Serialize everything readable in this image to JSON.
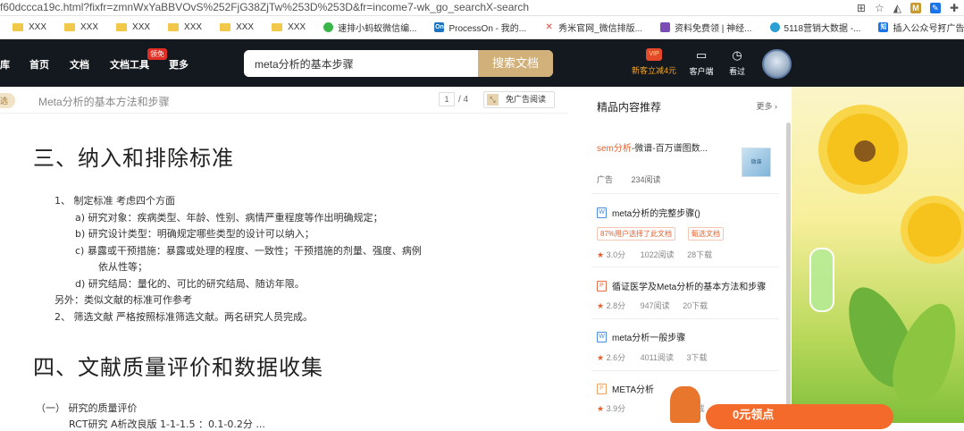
{
  "browser": {
    "url": "f60dccca19c.html?fixfr=zmnWxYaBBVOvS%252FjG38ZjTw%253D%253D&fr=income7-wk_go_searchX-search"
  },
  "bookmarks": [
    {
      "label": "XXX",
      "icon": "folder-icon"
    },
    {
      "label": "XXX",
      "icon": "folder-icon"
    },
    {
      "label": "XXX",
      "icon": "folder-icon"
    },
    {
      "label": "XXX",
      "icon": "folder-icon"
    },
    {
      "label": "XXX",
      "icon": "folder-icon"
    },
    {
      "label": "XXX",
      "icon": "folder-icon"
    },
    {
      "label": "速排小蚂蚁微信编...",
      "icon": "site-icon",
      "color": "#3bb54a"
    },
    {
      "label": "ProcessOn - 我的...",
      "icon": "site-icon",
      "color": "#1e73be",
      "glyph": "On"
    },
    {
      "label": "秀米官网_微信排版...",
      "icon": "site-icon",
      "color": "#e0463c"
    },
    {
      "label": "资料免费领 | 神经...",
      "icon": "site-icon",
      "color": "#7b4bb6"
    },
    {
      "label": "5118营销大数据 -...",
      "icon": "site-icon",
      "color": "#2a9fd6"
    },
    {
      "label": "插入公众号打广告...",
      "icon": "site-icon",
      "color": "#1a73e8",
      "glyph": "知"
    }
  ],
  "header": {
    "logo_fragment": "库",
    "nav": [
      "首页",
      "文档",
      "文档工具",
      "更多"
    ],
    "hot_badge": "领免",
    "search_value": "meta分析的基本步骤",
    "search_button": "搜索文档",
    "vip_label": "新客立减4元",
    "vip_icon_text": "VIP",
    "client_label": "客户端",
    "history_label": "看过"
  },
  "docbar": {
    "tag": "选",
    "title": "Meta分析的基本方法和步骤",
    "page_current": "1",
    "page_total": "/ 4",
    "adfree": "免广告阅读"
  },
  "doc": {
    "h1": "三、纳入和排除标准",
    "lines": [
      "1、 制定标准 考虑四个方面",
      "a)    研究对象：疾病类型、年龄、性别、病情严重程度等作出明确规定；",
      "b)    研究设计类型：明确规定哪些类型的设计可以纳入；",
      "c)    暴露或干预措施：暴露或处理的程度、一致性；干预措施的剂量、强度、病例",
      "依从性等；",
      "d)    研究结局：量化的、可比的研究结局、随访年限。",
      "另外：类似文献的标准可作参考",
      "2、 筛选文献 严格按照标准筛选文献。两名研究人员完成。"
    ],
    "h2": "四、文献质量评价和数据收集",
    "lines2": [
      "（一）  研究的质量评价",
      "RCT研究  A析改良版 1-1-1.5  ：0.1-0.2分 ..."
    ]
  },
  "sidebar": {
    "title": "精品内容推荐",
    "more": "更多 ›",
    "ad": {
      "title_highlight": "sem分析",
      "title_rest": "-微谱-百万谱图数...",
      "thumb_text": "微谱",
      "tag": "广告",
      "reads": "234阅读"
    },
    "items": [
      {
        "type": "W",
        "title": "meta分析的完整步骤()",
        "chips": [
          "87%用户选择了此文档",
          "甄选文档"
        ],
        "rating": "3.0分",
        "reads": "1022阅读",
        "downloads": "28下载"
      },
      {
        "type": "P",
        "title": "循证医学及Meta分析的基本方法和步骤",
        "rating": "2.8分",
        "reads": "947阅读",
        "downloads": "20下载"
      },
      {
        "type": "W",
        "title": "meta分析一般步骤",
        "rating": "2.6分",
        "reads": "4011阅读",
        "downloads": "3下载"
      },
      {
        "type": "P",
        "title": "META分析",
        "rating": "3.9分",
        "reads": "",
        "downloads": "下载"
      }
    ]
  },
  "promo": {
    "text": "0元领点"
  }
}
